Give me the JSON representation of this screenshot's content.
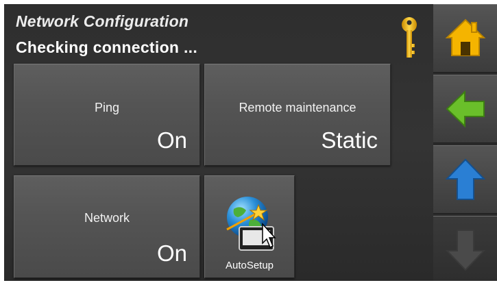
{
  "header": {
    "title": "Network Configuration",
    "status": "Checking connection ...",
    "key_icon": "key-icon"
  },
  "tiles": [
    {
      "id": "ping",
      "label": "Ping",
      "value": "On"
    },
    {
      "id": "remote",
      "label": "Remote maintenance",
      "value": "Static"
    },
    {
      "id": "network",
      "label": "Network",
      "value": "On"
    },
    {
      "id": "autosetup",
      "label": "AutoSetup",
      "icon": "globe-cursor-icon"
    }
  ],
  "sidebar": {
    "buttons": [
      {
        "id": "home",
        "icon": "home-icon",
        "color": "#f5b400"
      },
      {
        "id": "back",
        "icon": "arrow-left-icon",
        "color": "#6abf2a"
      },
      {
        "id": "up",
        "icon": "arrow-up-icon",
        "color": "#2a7fd4"
      },
      {
        "id": "down",
        "icon": "arrow-down-icon",
        "color": "#4a4a4a",
        "disabled": true
      }
    ]
  }
}
